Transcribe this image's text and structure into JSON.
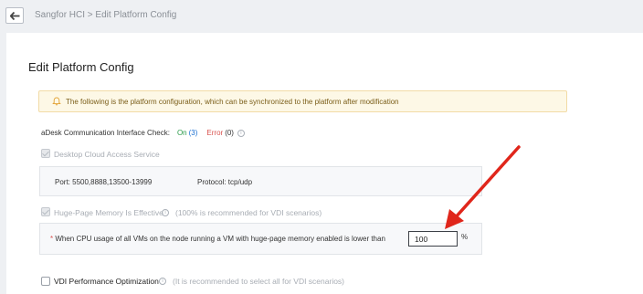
{
  "breadcrumb": {
    "back_icon": "back-arrow-icon",
    "path": "Sangfor HCI > Edit Platform Config"
  },
  "page": {
    "title": "Edit Platform Config"
  },
  "alert": {
    "icon": "bell-icon",
    "text": "The following is the platform configuration, which can be synchronized to the platform after modification"
  },
  "interface_check": {
    "label": "aDesk Communication Interface Check:",
    "on_label": "On",
    "on_count": "(3)",
    "error_label": "Error",
    "error_count": "(0)"
  },
  "desktop_cloud": {
    "label": "Desktop Cloud Access Service",
    "checked": true,
    "port": "Port: 5500,8888,13500-13999",
    "protocol": "Protocol: tcp/udp"
  },
  "huge_page": {
    "label": "Huge-Page Memory Is Effective",
    "hint": "(100% is recommended for VDI scenarios)",
    "checked": true,
    "required_mark": "*",
    "cpu_label": "When CPU usage of all VMs on the node running a VM with huge-page memory enabled is lower than",
    "cpu_value": "100",
    "unit": "%"
  },
  "vdi": {
    "label": "VDI Performance Optimization",
    "hint": "(It is recommended to select all for VDI scenarios)",
    "checked": false
  },
  "colors": {
    "on": "#2b9b4a",
    "error": "#d9534f",
    "annotation_arrow": "#e0261b"
  }
}
